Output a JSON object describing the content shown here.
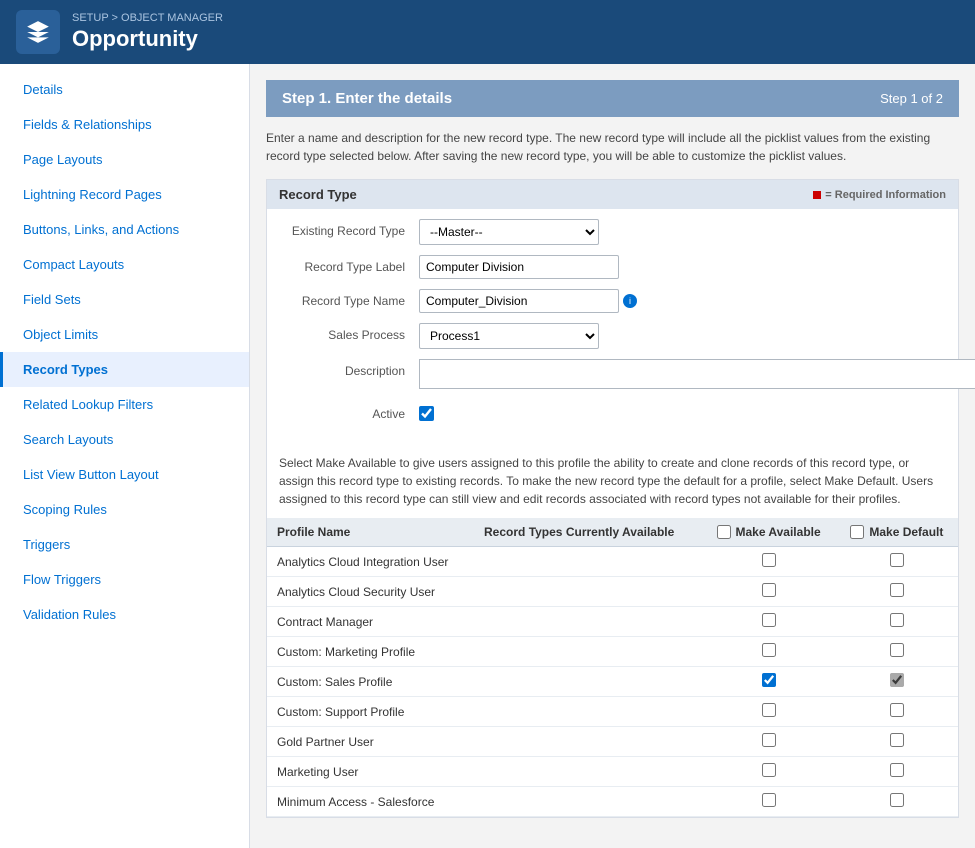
{
  "header": {
    "breadcrumb_setup": "SETUP",
    "breadcrumb_sep": " > ",
    "breadcrumb_manager": "OBJECT MANAGER",
    "title": "Opportunity",
    "icon_label": "salesforce-icon"
  },
  "sidebar": {
    "items": [
      {
        "id": "details",
        "label": "Details",
        "active": false
      },
      {
        "id": "fields-relationships",
        "label": "Fields & Relationships",
        "active": false
      },
      {
        "id": "page-layouts",
        "label": "Page Layouts",
        "active": false
      },
      {
        "id": "lightning-record-pages",
        "label": "Lightning Record Pages",
        "active": false
      },
      {
        "id": "buttons-links-actions",
        "label": "Buttons, Links, and Actions",
        "active": false
      },
      {
        "id": "compact-layouts",
        "label": "Compact Layouts",
        "active": false
      },
      {
        "id": "field-sets",
        "label": "Field Sets",
        "active": false
      },
      {
        "id": "object-limits",
        "label": "Object Limits",
        "active": false
      },
      {
        "id": "record-types",
        "label": "Record Types",
        "active": true
      },
      {
        "id": "related-lookup-filters",
        "label": "Related Lookup Filters",
        "active": false
      },
      {
        "id": "search-layouts",
        "label": "Search Layouts",
        "active": false
      },
      {
        "id": "list-view-button-layout",
        "label": "List View Button Layout",
        "active": false
      },
      {
        "id": "scoping-rules",
        "label": "Scoping Rules",
        "active": false
      },
      {
        "id": "triggers",
        "label": "Triggers",
        "active": false
      },
      {
        "id": "flow-triggers",
        "label": "Flow Triggers",
        "active": false
      },
      {
        "id": "validation-rules",
        "label": "Validation Rules",
        "active": false
      }
    ]
  },
  "main": {
    "step_title": "Step 1. Enter the details",
    "step_indicator": "Step 1 of 2",
    "description": "Enter a name and description for the new record type. The new record type will include all the picklist values from the existing record type selected below. After saving the new record type, you will be able to customize the picklist values.",
    "record_type_section": {
      "title": "Record Type",
      "required_label": "= Required Information",
      "fields": {
        "existing_record_type_label": "Existing Record Type",
        "existing_record_type_value": "--Master--",
        "record_type_label_label": "Record Type Label",
        "record_type_label_value": "Computer Division",
        "record_type_name_label": "Record Type Name",
        "record_type_name_value": "Computer_Division",
        "sales_process_label": "Sales Process",
        "sales_process_value": "Process1",
        "description_label": "Description",
        "description_value": "",
        "active_label": "Active"
      }
    },
    "profile_section": {
      "description": "Select Make Available to give users assigned to this profile the ability to create and clone records of this record type, or assign this record type to existing records. To make the new record type the default for a profile, select Make Default. Users assigned to this record type can still view and edit records associated with record types not available for their profiles.",
      "columns": {
        "profile_name": "Profile Name",
        "record_types_available": "Record Types Currently Available",
        "make_available": "Make Available",
        "make_default": "Make Default"
      },
      "rows": [
        {
          "id": 1,
          "profile": "Analytics Cloud Integration User",
          "available": false,
          "make_available": false,
          "make_default": false
        },
        {
          "id": 2,
          "profile": "Analytics Cloud Security User",
          "available": false,
          "make_available": false,
          "make_default": false
        },
        {
          "id": 3,
          "profile": "Contract Manager",
          "available": false,
          "make_available": false,
          "make_default": false
        },
        {
          "id": 4,
          "profile": "Custom: Marketing Profile",
          "available": false,
          "make_available": false,
          "make_default": false
        },
        {
          "id": 5,
          "profile": "Custom: Sales Profile",
          "available": false,
          "make_available": true,
          "make_default": true
        },
        {
          "id": 6,
          "profile": "Custom: Support Profile",
          "available": false,
          "make_available": false,
          "make_default": false
        },
        {
          "id": 7,
          "profile": "Gold Partner User",
          "available": false,
          "make_available": false,
          "make_default": false
        },
        {
          "id": 8,
          "profile": "Marketing User",
          "available": false,
          "make_available": false,
          "make_default": false
        },
        {
          "id": 9,
          "profile": "Minimum Access - Salesforce",
          "available": false,
          "make_available": false,
          "make_default": false
        }
      ]
    }
  }
}
